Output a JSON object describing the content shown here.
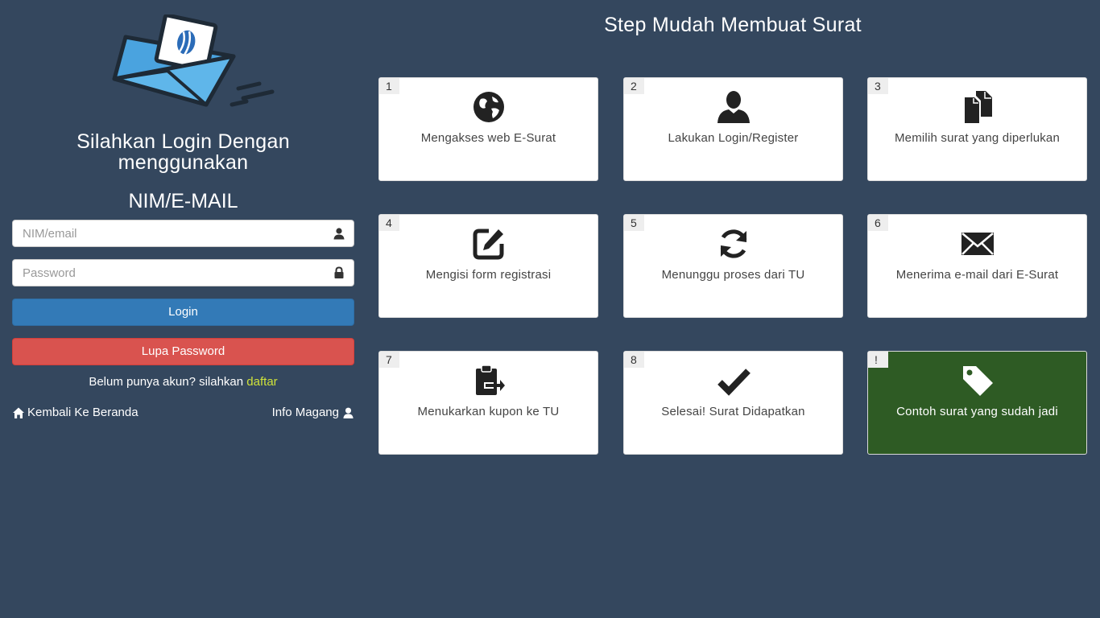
{
  "login": {
    "title": "Silahkan Login Dengan menggunakan",
    "subtitle": "NIM/E-MAIL",
    "username_placeholder": "NIM/email",
    "password_placeholder": "Password",
    "login_label": "Login",
    "forgot_label": "Lupa Password",
    "register_text": "Belum punya akun? silahkan",
    "register_link": "daftar",
    "home_link": "Kembali Ke Beranda",
    "intern_link": "Info Magang"
  },
  "steps": {
    "title": "Step Mudah Membuat Surat",
    "items": [
      {
        "num": "1",
        "label": "Mengakses web E-Surat",
        "icon": "globe-icon"
      },
      {
        "num": "2",
        "label": "Lakukan Login/Register",
        "icon": "user-icon"
      },
      {
        "num": "3",
        "label": "Memilih surat yang diperlukan",
        "icon": "documents-icon"
      },
      {
        "num": "4",
        "label": "Mengisi form registrasi",
        "icon": "edit-icon"
      },
      {
        "num": "5",
        "label": "Menunggu proses dari TU",
        "icon": "refresh-icon"
      },
      {
        "num": "6",
        "label": "Menerima e-mail dari E-Surat",
        "icon": "envelope-icon"
      },
      {
        "num": "7",
        "label": "Menukarkan kupon ke TU",
        "icon": "clipboard-icon"
      },
      {
        "num": "8",
        "label": "Selesai! Surat Didapatkan",
        "icon": "checkmark-icon"
      },
      {
        "num": "!",
        "label": "Contoh surat yang sudah jadi",
        "icon": "tag-icon"
      }
    ]
  },
  "colors": {
    "background": "#34475e",
    "login_button": "#337ab7",
    "forgot_button": "#d9534f",
    "register_link": "#cfe23a",
    "example_card": "#2e5b24"
  }
}
